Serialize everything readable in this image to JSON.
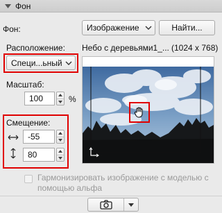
{
  "section": {
    "title": "Фон"
  },
  "background": {
    "label": "Фон:",
    "type_value": "Изображение",
    "browse_button": "Найти...",
    "image_name": "Небо с деревьями1_...",
    "image_size": "(1024 x 768)"
  },
  "placement": {
    "label": "Расположение:",
    "value": "Специ...ьный"
  },
  "scale": {
    "label": "Масштаб:",
    "value": "100",
    "unit": "%"
  },
  "offset": {
    "label": "Смещение:",
    "x_value": "-55",
    "y_value": "80"
  },
  "harmonize": {
    "label_line1": "Гармонизировать изображение с моделью с",
    "label_line2": "помощью альфа",
    "checked": false
  },
  "colors": {
    "highlight": "#e00000"
  },
  "icons": [
    "collapse-triangle-icon",
    "chevron-down-icon",
    "stepper-up-icon",
    "stepper-down-icon",
    "horizontal-offset-icon",
    "vertical-offset-icon",
    "hand-pan-icon",
    "camera-icon"
  ]
}
